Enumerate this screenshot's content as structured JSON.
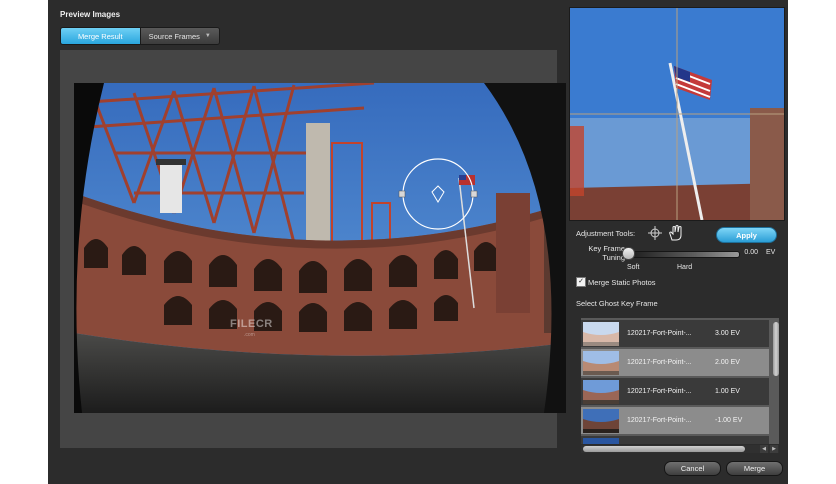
{
  "panel": {
    "title": "Preview Images"
  },
  "tabs": [
    {
      "label": "Merge Result",
      "active": true
    },
    {
      "label": "Source Frames",
      "active": false
    }
  ],
  "watermark": {
    "text": "FILECR",
    "subtext": ".com"
  },
  "adjustment": {
    "label": "Adjustment Tools:",
    "apply_label": "Apply",
    "tools": [
      "crosshair-icon",
      "hand-icon"
    ]
  },
  "key_frame_tuning": {
    "label": "Key Frame Tuning",
    "value": "0.00",
    "unit": "EV",
    "min_label": "Soft",
    "max_label": "Hard",
    "position": 0.0
  },
  "merge_static": {
    "label": "Merge Static Photos",
    "checked": true
  },
  "ghost": {
    "label": "Select Ghost Key Frame",
    "frames": [
      {
        "name": "120217-Fort-Point-...",
        "ev": "3.00 EV",
        "selected": false
      },
      {
        "name": "120217-Fort-Point-...",
        "ev": "2.00 EV",
        "selected": true
      },
      {
        "name": "120217-Fort-Point-...",
        "ev": "1.00 EV",
        "selected": false
      },
      {
        "name": "120217-Fort-Point-...",
        "ev": "-1.00 EV",
        "selected": true
      }
    ]
  },
  "footer": {
    "cancel_label": "Cancel",
    "merge_label": "Merge"
  },
  "colors": {
    "accent": "#2aa6de",
    "panel": "#2c2c2c",
    "sky": "#2f6fc4",
    "brick": "#8a4a3a"
  }
}
